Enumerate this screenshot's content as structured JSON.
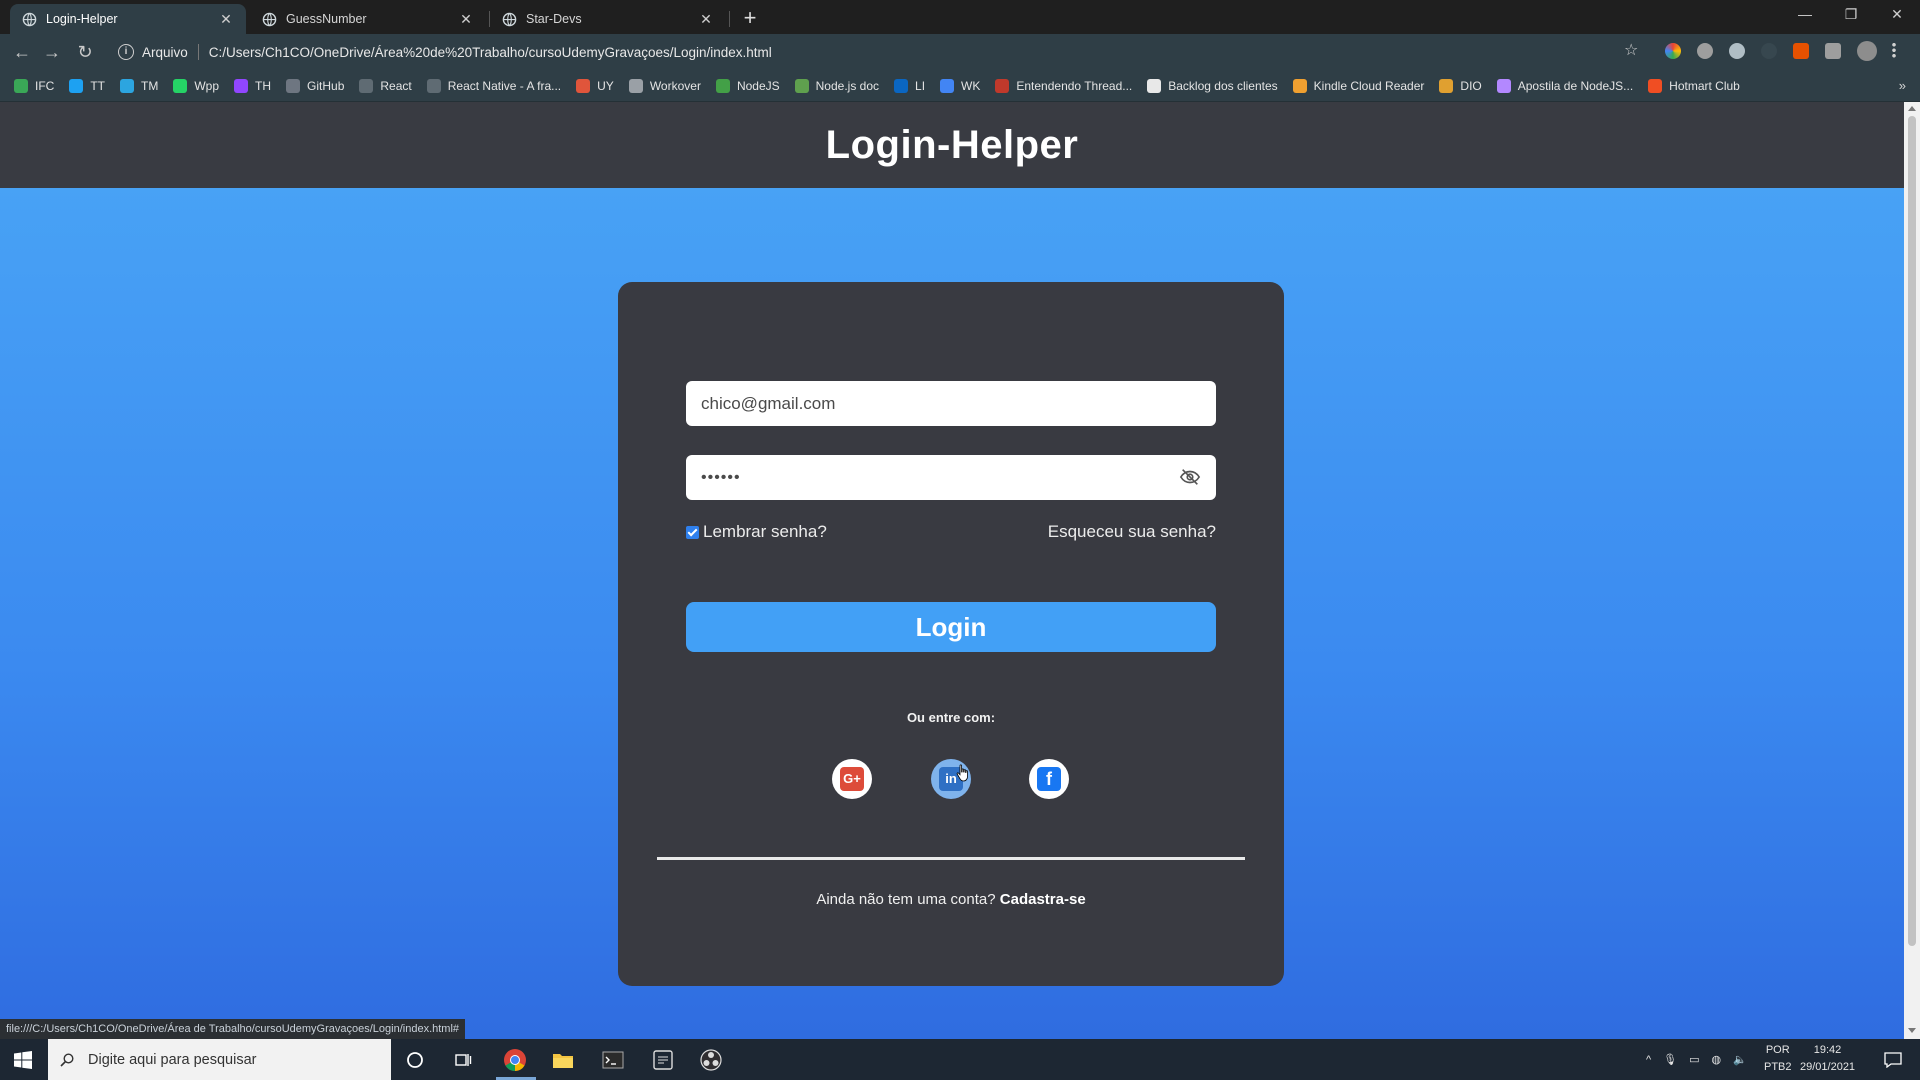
{
  "browser": {
    "tabs": [
      {
        "label": "Login-Helper",
        "active": true
      },
      {
        "label": "GuessNumber",
        "active": false
      },
      {
        "label": "Star-Devs",
        "active": false
      }
    ],
    "new_tab_label": "+",
    "address": {
      "scheme_label": "Arquivo",
      "url": "C:/Users/Ch1CO/OneDrive/Área%20de%20Trabalho/cursoUdemyGravaçoes/Login/index.html"
    },
    "bookmarks": [
      {
        "label": "IFC",
        "color": "#3aa757"
      },
      {
        "label": "TT",
        "color": "#1da1f2"
      },
      {
        "label": "TM",
        "color": "#2ca5e0"
      },
      {
        "label": "Wpp",
        "color": "#25d366"
      },
      {
        "label": "TH",
        "color": "#9146ff"
      },
      {
        "label": "GitHub",
        "color": "#6e7681"
      },
      {
        "label": "React",
        "color": "#5f6b73"
      },
      {
        "label": "React Native - A fra...",
        "color": "#5f6b73"
      },
      {
        "label": "UY",
        "color": "#e0553b"
      },
      {
        "label": "Workover",
        "color": "#9aa0a6"
      },
      {
        "label": "NodeJS",
        "color": "#43a047"
      },
      {
        "label": "Node.js doc",
        "color": "#5fa04e"
      },
      {
        "label": "LI",
        "color": "#0a66c2"
      },
      {
        "label": "WK",
        "color": "#4285f4"
      },
      {
        "label": "Entendendo Thread...",
        "color": "#c0392b"
      },
      {
        "label": "Backlog dos clientes",
        "color": "#e8e8e8"
      },
      {
        "label": "Kindle Cloud Reader",
        "color": "#f0a030"
      },
      {
        "label": "DIO",
        "color": "#e0a030"
      },
      {
        "label": "Apostila de NodeJS...",
        "color": "#b388ff"
      },
      {
        "label": "Hotmart Club",
        "color": "#f04e23"
      }
    ],
    "bookmarks_overflow": "»"
  },
  "page": {
    "title": "Login-Helper",
    "form": {
      "email_value": "chico@gmail.com",
      "password_value": "••••••",
      "remember_label": "Lembrar senha?",
      "remember_checked": true,
      "forgot_label": "Esqueceu sua senha?",
      "login_label": "Login",
      "or_label": "Ou entre com:",
      "social": [
        {
          "name": "google",
          "glyph": "G+",
          "color": "#dd4b39"
        },
        {
          "name": "linkedin",
          "glyph": "in",
          "color": "#2f70c4"
        },
        {
          "name": "facebook",
          "glyph": "f",
          "color": "#1877f2"
        }
      ],
      "signup_prompt": "Ainda não tem uma conta?",
      "signup_link": "Cadastra-se"
    },
    "status_url": "file:///C:/Users/Ch1CO/OneDrive/Área de Trabalho/cursoUdemyGravaçoes/Login/index.html#"
  },
  "taskbar": {
    "search_placeholder": "Digite aqui para pesquisar",
    "language": "POR",
    "layout": "PTB2",
    "time": "19:42",
    "date": "29/01/2021"
  },
  "colors": {
    "page_gradient_top": "#4aa6f6",
    "page_gradient_bottom": "#2f6ce0",
    "card_bg": "#393a41",
    "header_bg": "#393b42",
    "login_button": "#42a0f6"
  }
}
